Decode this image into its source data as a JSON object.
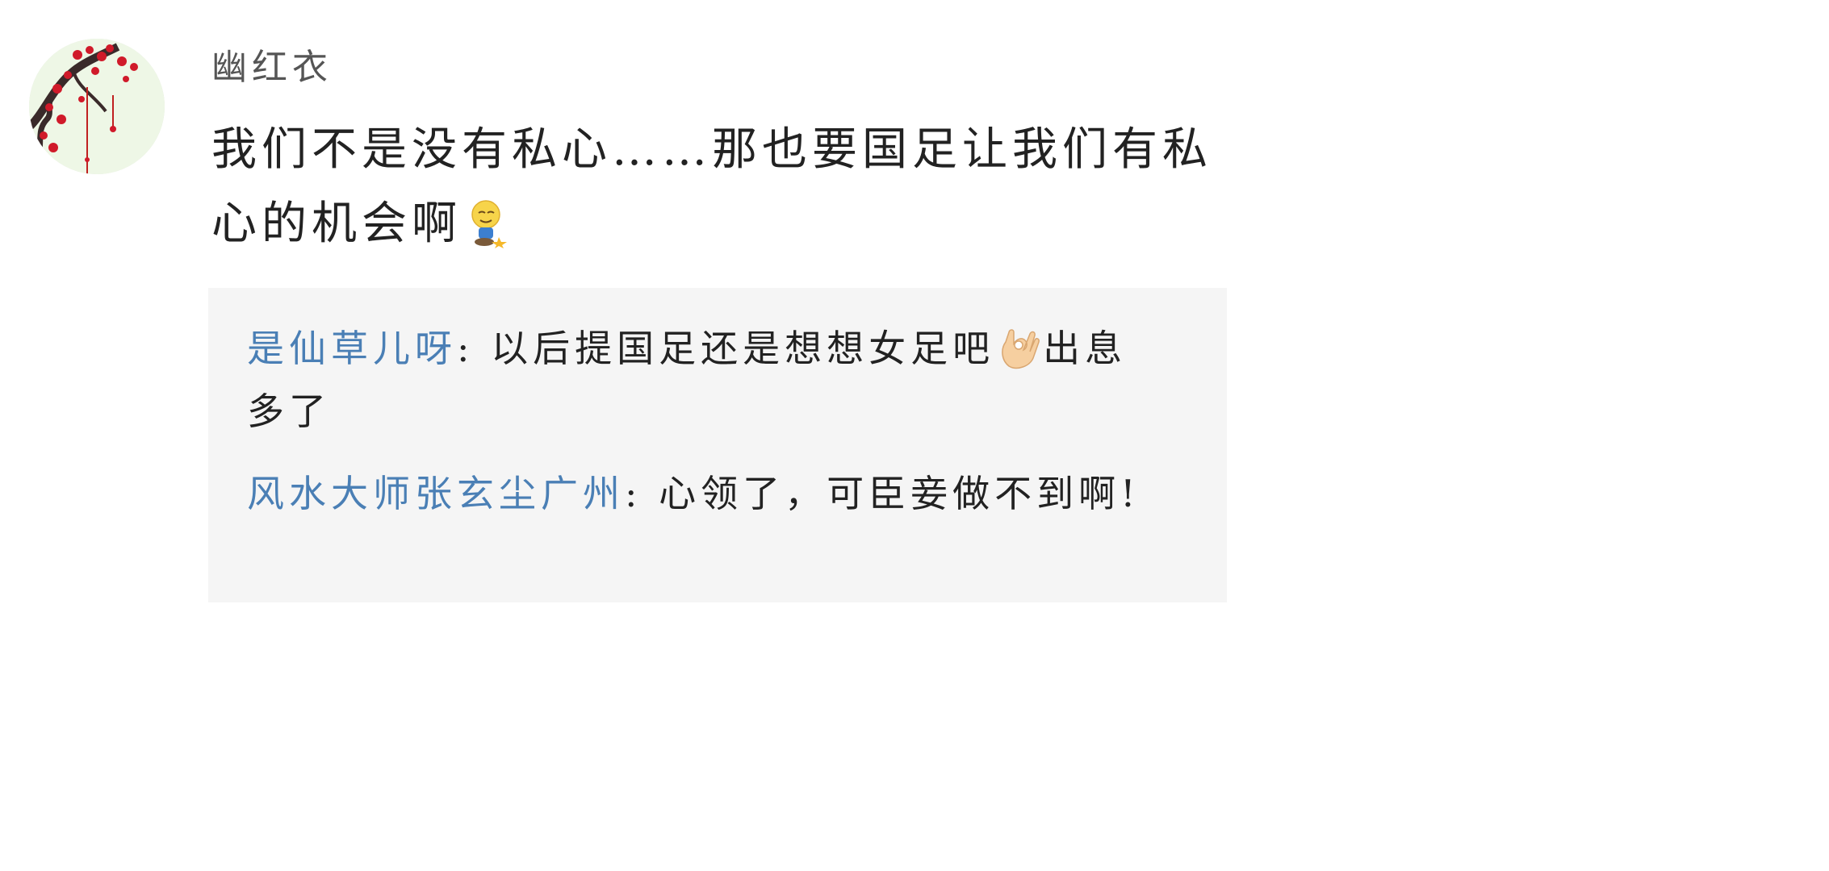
{
  "comment": {
    "username": "幽红衣",
    "text": "我们不是没有私心……那也要国足让我们有私心的机会啊",
    "emoji": "kneeling-smile-emoji"
  },
  "replies": [
    {
      "name": "是仙草儿呀",
      "separator": ": ",
      "text_before": "以后提国足还是想想女足吧",
      "emoji": "ok-hand-emoji",
      "text_after": "出息多了"
    },
    {
      "name": "风水大师张玄尘广州",
      "separator": ": ",
      "text_before": "心领了，可臣妾做不到啊!",
      "emoji": "",
      "text_after": ""
    }
  ],
  "colors": {
    "reply_name": "#4a7fb5",
    "reply_background": "#f5f5f5",
    "username": "#555555",
    "body": "#222222"
  }
}
